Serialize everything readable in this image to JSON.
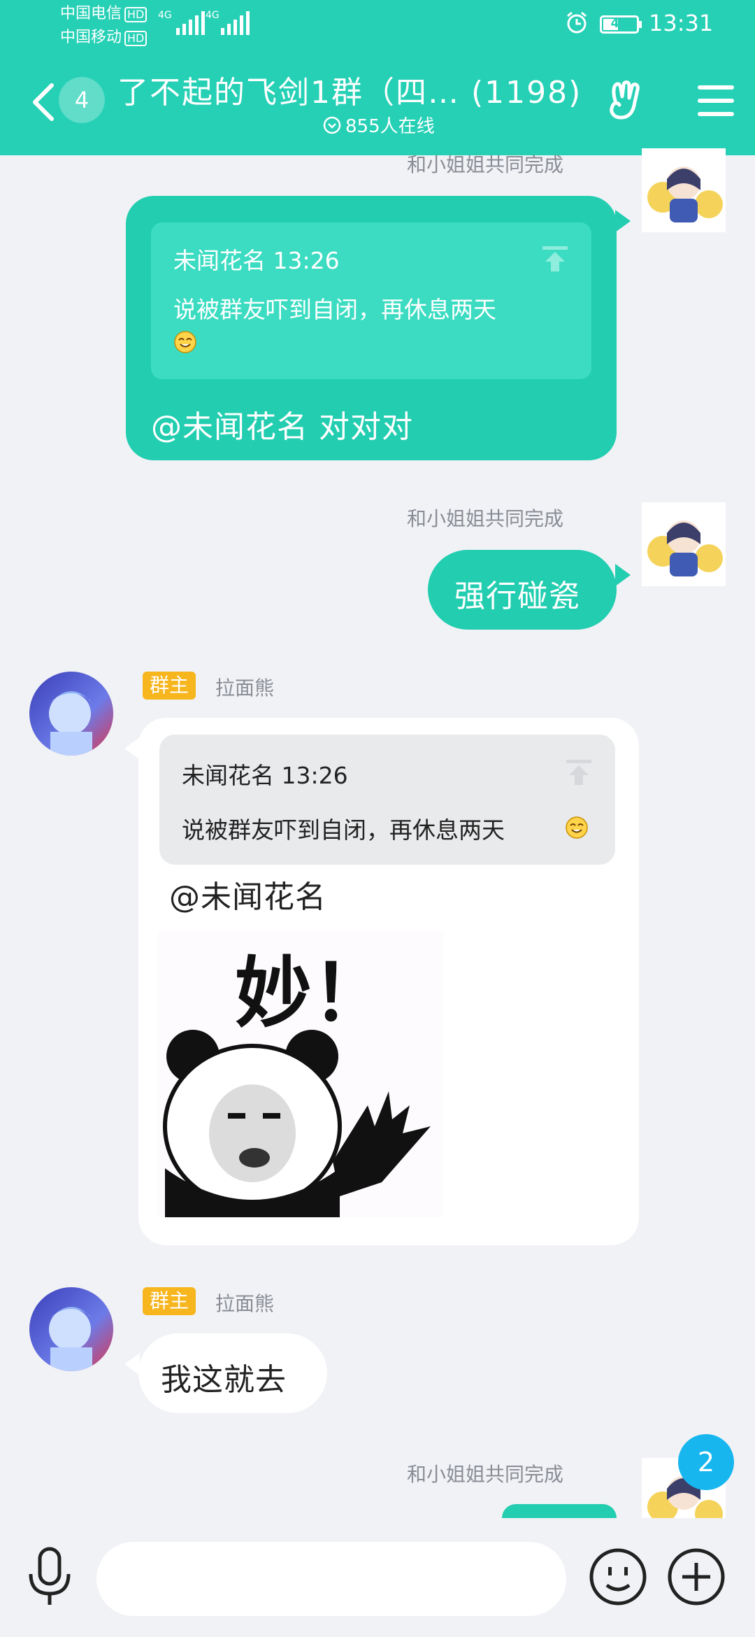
{
  "status_bar": {
    "carrier1": "中国电信",
    "carrier2": "中国移动",
    "hd": "HD",
    "net": "4G",
    "battery": "41",
    "time": "13:31"
  },
  "header": {
    "unread_count": "4",
    "title": "了不起的飞剑1群（四…  (1198)",
    "online_text": "855人在线"
  },
  "messages": [
    {
      "sender": "和小姐姐共同完成",
      "quote": {
        "author_time": "未闻花名 13:26",
        "text": "说被群友吓到自闭，再休息两天"
      },
      "reply": "@未闻花名 对对对"
    },
    {
      "sender": "和小姐姐共同完成",
      "text": "强行碰瓷"
    },
    {
      "role": "群主",
      "sender": "拉面熊",
      "quote": {
        "author_time": "未闻花名 13:26",
        "text": "说被群友吓到自闭，再休息两天"
      },
      "mention": "@未闻花名",
      "sticker_text": "妙！"
    },
    {
      "role": "群主",
      "sender": "拉面熊",
      "text": "我这就去"
    },
    {
      "sender": "和小姐姐共同完成"
    }
  ],
  "float_badge": "2",
  "colors": {
    "brand": "#25d0b5",
    "bubble_self": "#22cdb0",
    "role_badge": "#f7b51e",
    "float_badge": "#17b6ef"
  }
}
